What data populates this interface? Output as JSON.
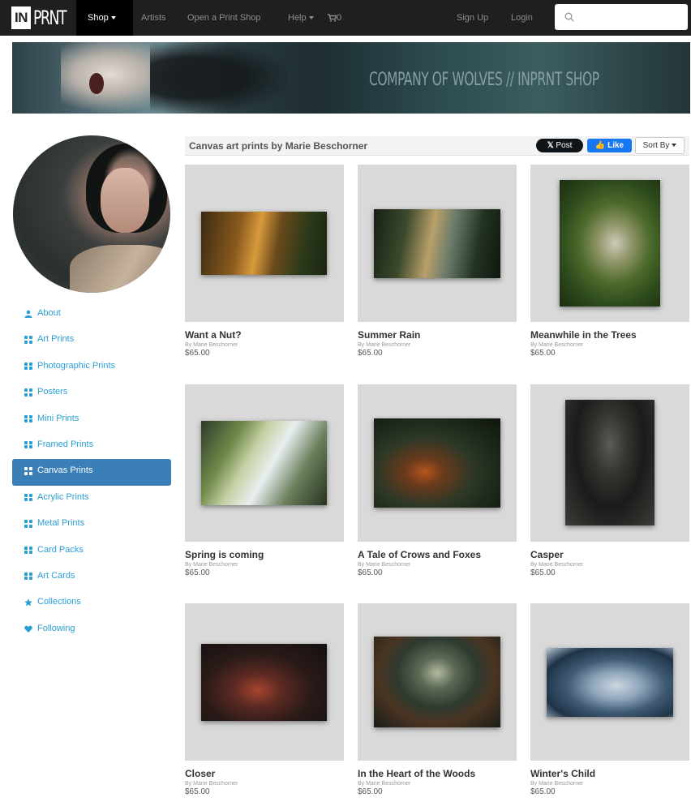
{
  "navbar": {
    "logo_box": "IN",
    "logo_text": "PRNT",
    "items": [
      {
        "label": "Shop"
      },
      {
        "label": "Artists"
      },
      {
        "label": "Open a Print Shop"
      },
      {
        "label": "Help"
      },
      {
        "label": "0"
      },
      {
        "label": "Sign Up"
      },
      {
        "label": "Login"
      }
    ],
    "search_placeholder": ""
  },
  "banner": {
    "title": "COMPANY OF WOLVES  //  INPRNT SHOP"
  },
  "sidebar": {
    "items": [
      {
        "label": "About",
        "icon": "user-icon"
      },
      {
        "label": "Art Prints",
        "icon": "grid-icon"
      },
      {
        "label": "Photographic Prints",
        "icon": "grid-icon"
      },
      {
        "label": "Posters",
        "icon": "grid-icon"
      },
      {
        "label": "Mini Prints",
        "icon": "grid-icon"
      },
      {
        "label": "Framed Prints",
        "icon": "grid-icon"
      },
      {
        "label": "Canvas Prints",
        "icon": "grid-icon",
        "active": true
      },
      {
        "label": "Acrylic Prints",
        "icon": "grid-icon"
      },
      {
        "label": "Metal Prints",
        "icon": "grid-icon"
      },
      {
        "label": "Card Packs",
        "icon": "grid-icon"
      },
      {
        "label": "Art Cards",
        "icon": "grid-icon"
      },
      {
        "label": "Collections",
        "icon": "star-icon"
      },
      {
        "label": "Following",
        "icon": "heart-icon"
      }
    ]
  },
  "content": {
    "title": "Canvas art prints by Marie Beschorner",
    "post_label": "Post",
    "like_label": "Like",
    "sort_label": "Sort By"
  },
  "products": [
    {
      "title": "Want a Nut?",
      "artist": "By Marie Beschorner",
      "price": "$65.00"
    },
    {
      "title": "Summer Rain",
      "artist": "By Marie Beschorner",
      "price": "$65.00"
    },
    {
      "title": "Meanwhile in the Trees",
      "artist": "By Marie Beschorner",
      "price": "$65.00"
    },
    {
      "title": "Spring is coming",
      "artist": "By Marie Beschorner",
      "price": "$65.00"
    },
    {
      "title": "A Tale of Crows and Foxes",
      "artist": "By Marie Beschorner",
      "price": "$65.00"
    },
    {
      "title": "Casper",
      "artist": "By Marie Beschorner",
      "price": "$65.00"
    },
    {
      "title": "Closer",
      "artist": "By Marie Beschorner",
      "price": "$65.00"
    },
    {
      "title": "In the Heart of the Woods",
      "artist": "By Marie Beschorner",
      "price": "$65.00"
    },
    {
      "title": "Winter's Child",
      "artist": "By Marie Beschorner",
      "price": "$65.00"
    }
  ],
  "colors": {
    "navbar_bg": "#1f1f1f",
    "link": "#2a9fd6",
    "active_sidebar": "#3a7fb7",
    "frame_bg": "#d9d9d9"
  }
}
